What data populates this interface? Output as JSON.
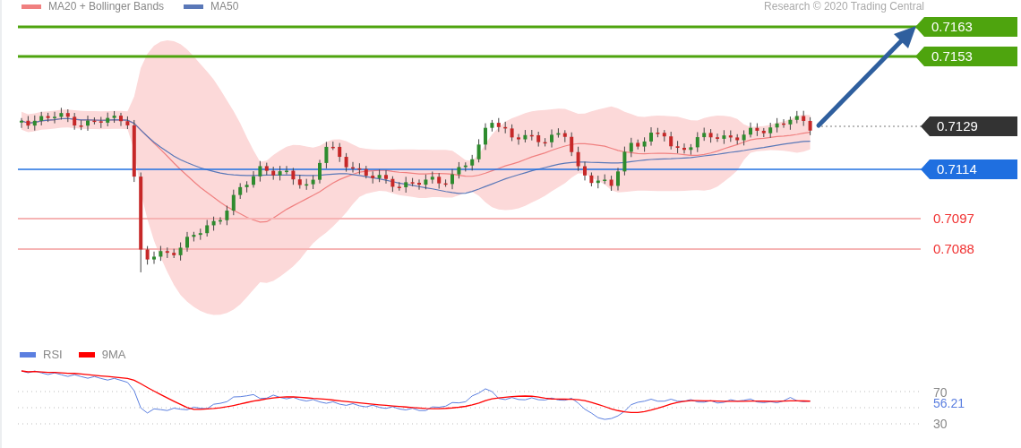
{
  "legend": [
    {
      "label": "MA20 + Bollinger Bands",
      "color": "#f08080"
    },
    {
      "label": "MA50",
      "color": "#5a78b8"
    }
  ],
  "credit": "Research © 2020 Trading Central",
  "levels": [
    {
      "kind": "resistance",
      "value": "0.7163"
    },
    {
      "kind": "resistance",
      "value": "0.7153"
    },
    {
      "kind": "last",
      "value": "0.7129"
    },
    {
      "kind": "pivot",
      "value": "0.7114"
    },
    {
      "kind": "support",
      "value": "0.7097"
    },
    {
      "kind": "support",
      "value": "0.7088"
    }
  ],
  "rsi": {
    "legend": [
      {
        "label": "RSI",
        "color": "#5b7fe0"
      },
      {
        "label": "9MA",
        "color": "#ff0000"
      }
    ],
    "levels": [
      {
        "kind": "bound",
        "value": "70"
      },
      {
        "kind": "current",
        "value": "56.21"
      },
      {
        "kind": "bound",
        "value": "30"
      }
    ]
  }
}
